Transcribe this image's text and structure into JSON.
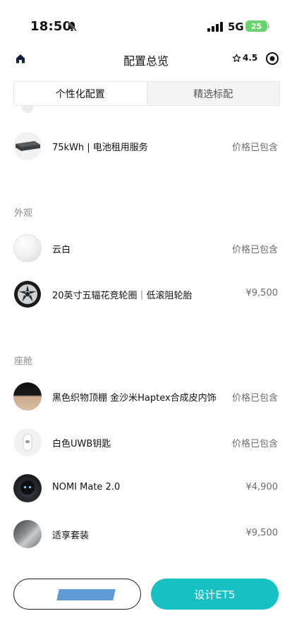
{
  "status_bar": {
    "time": "18:50",
    "network": "5G",
    "battery": "25",
    "icons": [
      "bell-muted-icon",
      "signal-icon",
      "battery-icon"
    ]
  },
  "nav": {
    "title": "配置总览",
    "rating": "4.5",
    "icons": [
      "home-icon",
      "star-icon",
      "target-icon"
    ]
  },
  "tabs": [
    {
      "label": "个性化配置",
      "active": true
    },
    {
      "label": "精选标配",
      "active": false
    }
  ],
  "sections": [
    {
      "title": "",
      "items": [
        {
          "name": "75kWh | 电池租用服务",
          "price": "价格已包含",
          "thumb": "battery-pack"
        }
      ]
    },
    {
      "title": "外观",
      "items": [
        {
          "name": "云白",
          "price": "价格已包含",
          "thumb": "white-paint"
        },
        {
          "name": "20英寸五辐花竞轮圈｜低滚阻轮胎",
          "price": "¥9,500",
          "thumb": "wheel"
        }
      ]
    },
    {
      "title": "座舱",
      "items": [
        {
          "name": "黑色织物顶棚 金沙米Haptex合成皮内饰",
          "price": "价格已包含",
          "thumb": "interior"
        },
        {
          "name": "白色UWB钥匙",
          "price": "价格已包含",
          "thumb": "uwb-key"
        },
        {
          "name": "NOMI Mate 2.0",
          "price": "¥4,900",
          "thumb": "nomi"
        },
        {
          "name": "适享套装",
          "price": "¥9,500",
          "thumb": "seat"
        }
      ]
    }
  ],
  "bottom": {
    "primary_label": "设计ET5"
  },
  "colors": {
    "accent": "#17c0c2",
    "battery": "#6ad46c",
    "redaction": "#4d8fd1"
  }
}
